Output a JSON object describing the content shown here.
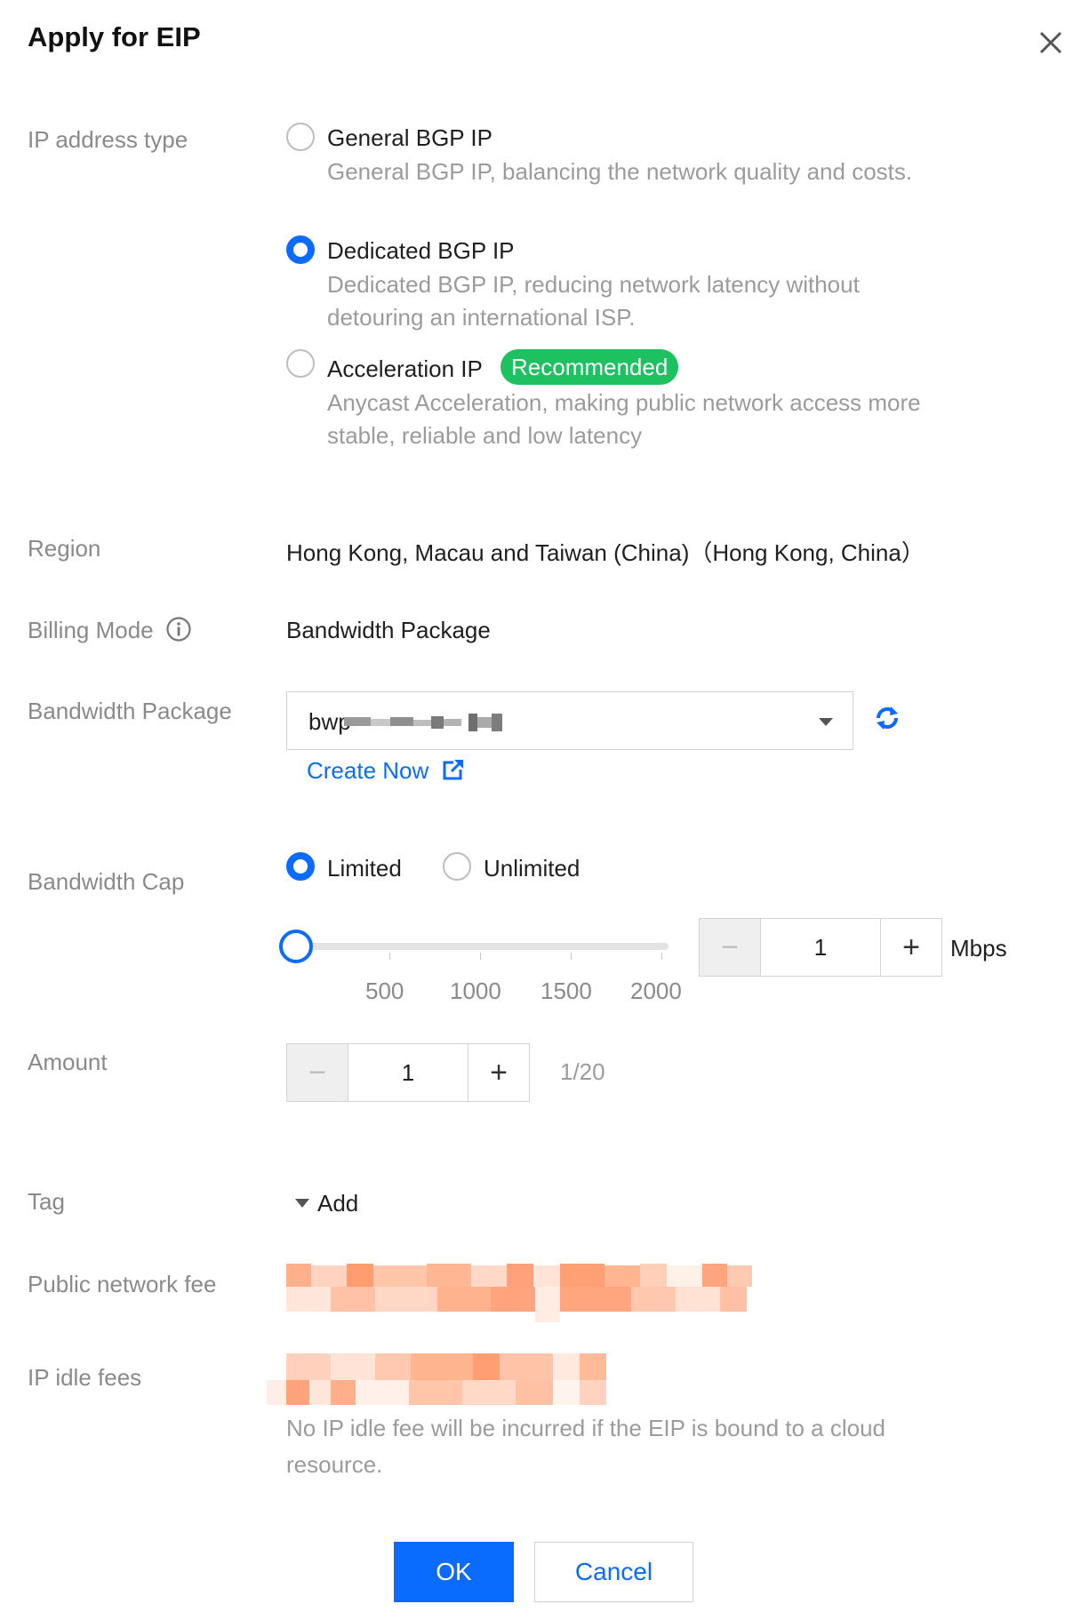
{
  "dialog": {
    "title": "Apply for EIP",
    "close_icon": "close-icon"
  },
  "ip_type": {
    "label": "IP address type",
    "options": [
      {
        "title": "General BGP IP",
        "desc": "General BGP IP, balancing the network quality and costs.",
        "selected": false
      },
      {
        "title": "Dedicated BGP IP",
        "desc": "Dedicated BGP IP, reducing network latency without detouring an international ISP.",
        "selected": true
      },
      {
        "title": "Acceleration IP",
        "badge": "Recommended",
        "desc": "Anycast Acceleration, making public network access more stable, reliable and low latency",
        "selected": false
      }
    ]
  },
  "region": {
    "label": "Region",
    "value": "Hong Kong, Macau and Taiwan (China)（Hong Kong, China）"
  },
  "billing": {
    "label": "Billing Mode",
    "info_icon": "info-icon",
    "value": "Bandwidth Package"
  },
  "bandwidth_package": {
    "label": "Bandwidth Package",
    "value_prefix": "bwp",
    "refresh_icon": "refresh-icon",
    "create_link": "Create Now",
    "external_icon": "external-link-icon"
  },
  "bandwidth_cap": {
    "label": "Bandwidth Cap",
    "options": [
      {
        "label": "Limited",
        "selected": true
      },
      {
        "label": "Unlimited",
        "selected": false
      }
    ],
    "slider_value": 1,
    "ticks": [
      "500",
      "1000",
      "1500",
      "2000"
    ],
    "value": "1",
    "unit": "Mbps"
  },
  "amount": {
    "label": "Amount",
    "value": "1",
    "quota": "1/20"
  },
  "tag": {
    "label": "Tag",
    "add_label": "Add"
  },
  "fees": {
    "public_label": "Public network fee",
    "idle_label": "IP idle fees",
    "idle_note": "No IP idle fee will be incurred if the EIP is bound to a cloud resource."
  },
  "footer": {
    "ok_label": "OK",
    "cancel_label": "Cancel"
  },
  "colors": {
    "accent": "#0a6cff",
    "badge": "#1ec15f"
  }
}
